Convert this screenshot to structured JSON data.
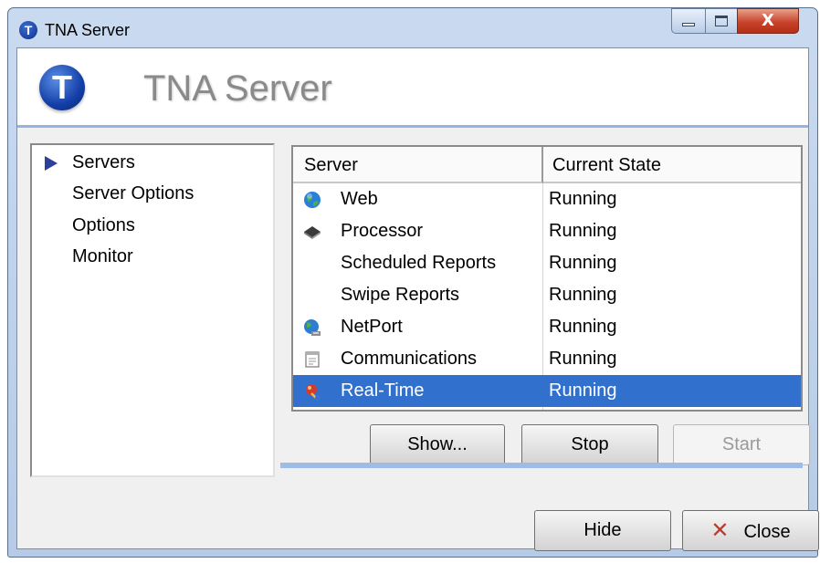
{
  "window": {
    "title": "TNA Server",
    "app_icon_letter": "T",
    "controls": {
      "minimize_icon": "minimize-icon",
      "maximize_icon": "maximize-icon",
      "close_glyph": "X"
    }
  },
  "header": {
    "logo_letter": "T",
    "title": "TNA Server"
  },
  "nav": {
    "items": [
      {
        "label": "Servers",
        "selected": true
      },
      {
        "label": "Server Options",
        "selected": false
      },
      {
        "label": "Options",
        "selected": false
      },
      {
        "label": "Monitor",
        "selected": false
      }
    ]
  },
  "table": {
    "columns": [
      "Server",
      "Current State"
    ],
    "rows": [
      {
        "name": "Web",
        "state": "Running",
        "icon": "globe-icon",
        "selected": false
      },
      {
        "name": "Processor",
        "state": "Running",
        "icon": "chip-icon",
        "selected": false
      },
      {
        "name": "Scheduled Reports",
        "state": "Running",
        "icon": "",
        "selected": false
      },
      {
        "name": "Swipe Reports",
        "state": "Running",
        "icon": "",
        "selected": false
      },
      {
        "name": "NetPort",
        "state": "Running",
        "icon": "network-globe-icon",
        "selected": false
      },
      {
        "name": "Communications",
        "state": "Running",
        "icon": "document-icon",
        "selected": false
      },
      {
        "name": "Real-Time",
        "state": "Running",
        "icon": "realtime-icon",
        "selected": true
      }
    ]
  },
  "actions": {
    "show": "Show...",
    "stop": "Stop",
    "start": "Start",
    "start_enabled": false
  },
  "footer": {
    "hide": "Hide",
    "close": "Close",
    "close_icon": "x-icon"
  },
  "colors": {
    "selection": "#3170cc",
    "nav_arrow": "#2b3f9c",
    "header_rule": "#93b4e0",
    "close_button": "#c8432b"
  }
}
